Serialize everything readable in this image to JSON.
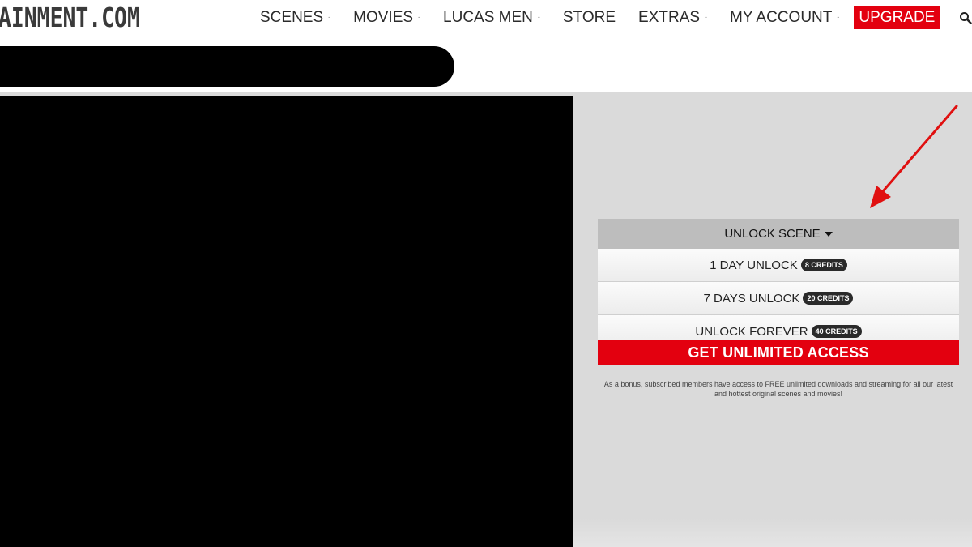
{
  "header": {
    "logo_text": "AINMENT.COM",
    "nav": [
      {
        "label": "SCENES",
        "has_dropdown": true
      },
      {
        "label": "MOVIES",
        "has_dropdown": true
      },
      {
        "label": "LUCAS MEN",
        "has_dropdown": true
      },
      {
        "label": "STORE",
        "has_dropdown": false
      },
      {
        "label": "EXTRAS",
        "has_dropdown": true
      },
      {
        "label": "MY ACCOUNT",
        "has_dropdown": true
      }
    ],
    "upgrade_label": "UPGRADE",
    "dropdown_caret": "-",
    "search_icon": "search-icon"
  },
  "unlock": {
    "header_label": "UNLOCK SCENE",
    "options": [
      {
        "label": "1 DAY UNLOCK",
        "badge": "8 CREDITS"
      },
      {
        "label": "7 DAYS UNLOCK",
        "badge": "20 CREDITS"
      },
      {
        "label": "UNLOCK FOREVER",
        "badge": "40 CREDITS"
      }
    ],
    "cta_label": "GET UNLIMITED ACCESS",
    "bonus_text": "As a bonus, subscribed members have access to FREE unlimited downloads and streaming for all our latest and hottest original scenes and movies!"
  },
  "colors": {
    "accent_red": "#e3000f",
    "panel_bg": "#dadada",
    "header_gray": "#bdbdbd",
    "annotation_arrow": "#e01010"
  }
}
